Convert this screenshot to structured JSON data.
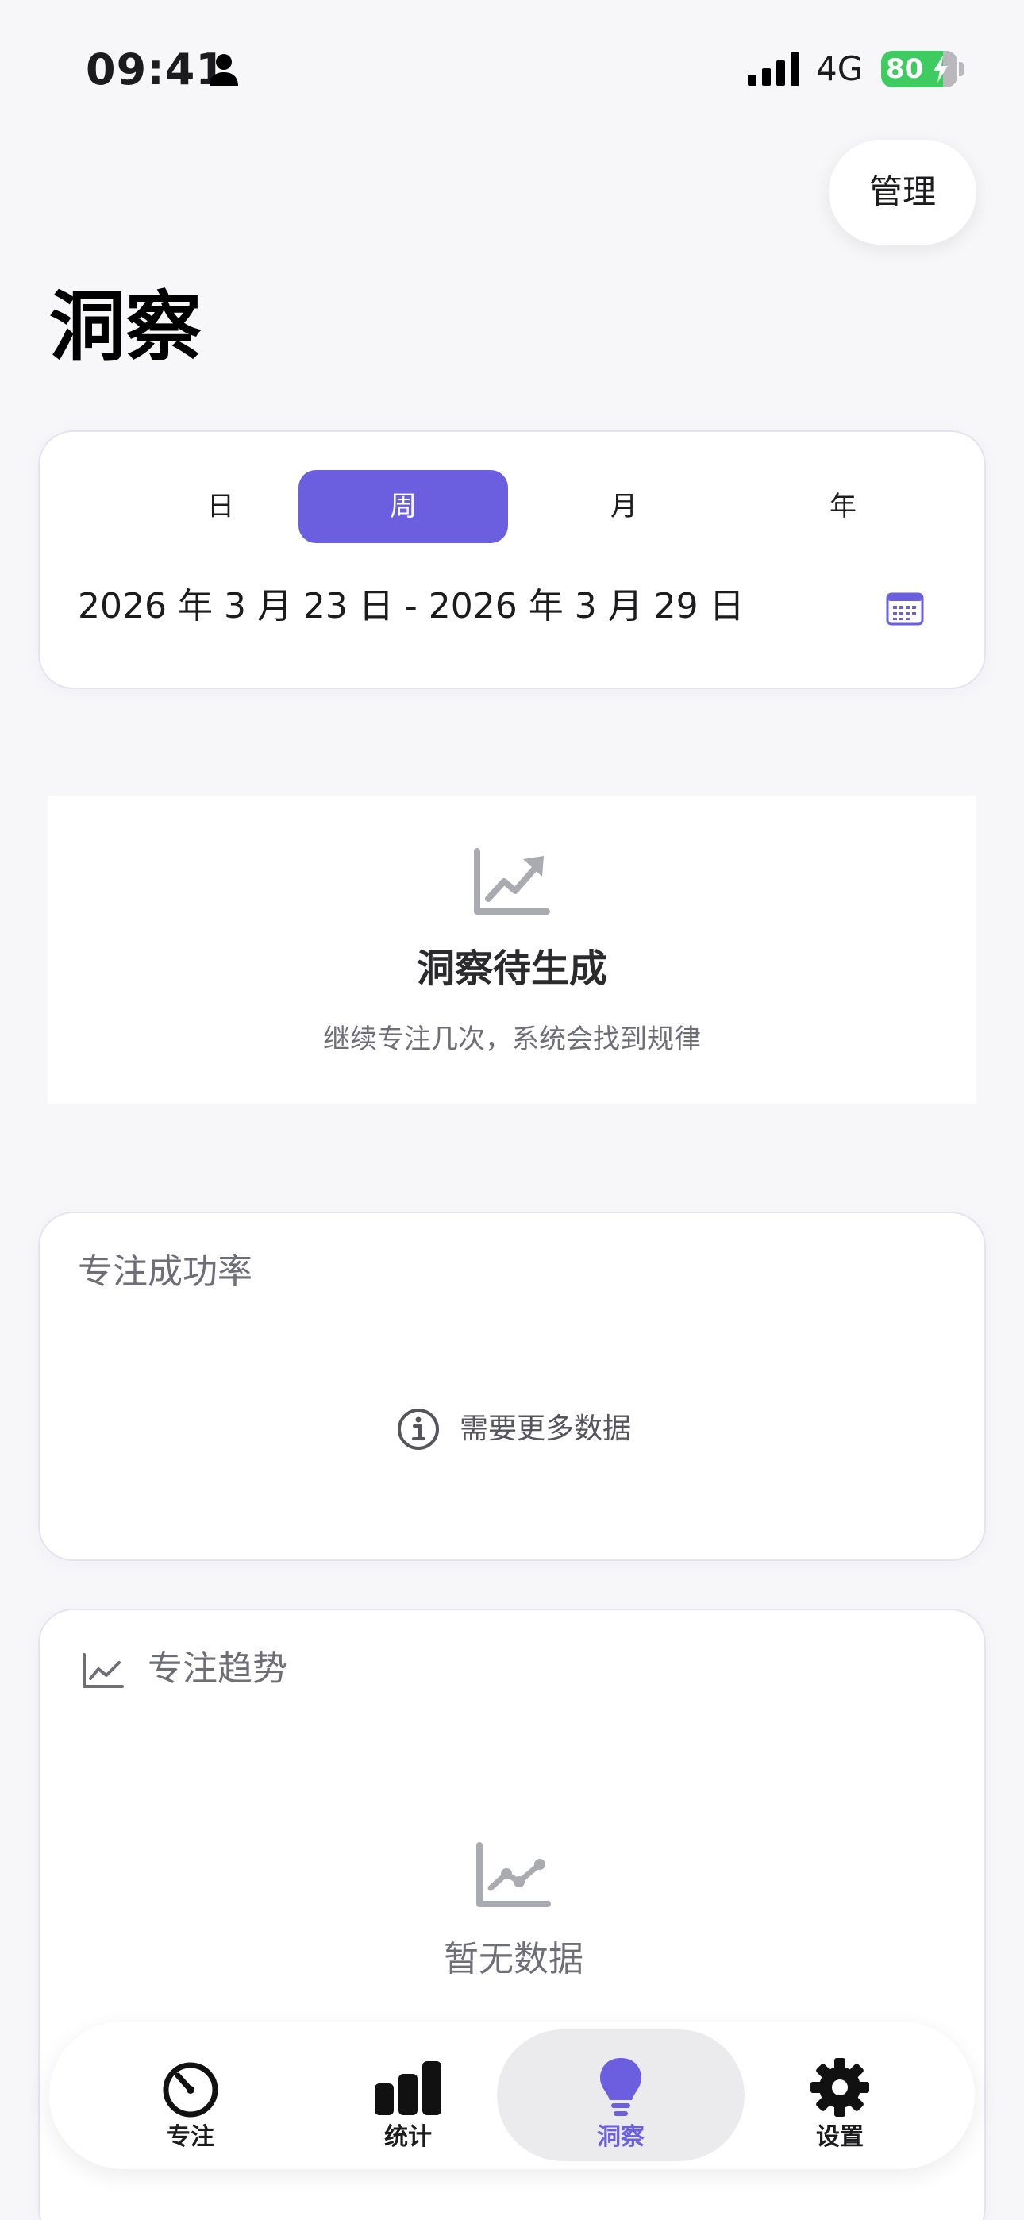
{
  "status_bar": {
    "time": "09:41",
    "network": "4G",
    "battery": "80"
  },
  "header": {
    "manage_label": "管理",
    "title": "洞察"
  },
  "period": {
    "segments": [
      {
        "label": "日",
        "active": false
      },
      {
        "label": "周",
        "active": true
      },
      {
        "label": "月",
        "active": false
      },
      {
        "label": "年",
        "active": false
      }
    ],
    "date_range": "2026 年 3 月 23 日 - 2026 年 3 月 29 日"
  },
  "insight": {
    "title": "洞察待生成",
    "subtitle": "继续专注几次，系统会找到规律"
  },
  "success_rate": {
    "title": "专注成功率",
    "message": "需要更多数据"
  },
  "trend": {
    "title": "专注趋势",
    "empty_text": "暂无数据"
  },
  "tabs": [
    {
      "label": "专注",
      "icon": "timer-icon",
      "active": false
    },
    {
      "label": "统计",
      "icon": "bar-chart-icon",
      "active": false
    },
    {
      "label": "洞察",
      "icon": "lightbulb-icon",
      "active": true
    },
    {
      "label": "设置",
      "icon": "gear-icon",
      "active": false
    }
  ],
  "colors": {
    "accent": "#6b5fe0",
    "battery": "#3ecb5f",
    "background": "#f7f7f9",
    "muted_text": "#6e6e76"
  }
}
